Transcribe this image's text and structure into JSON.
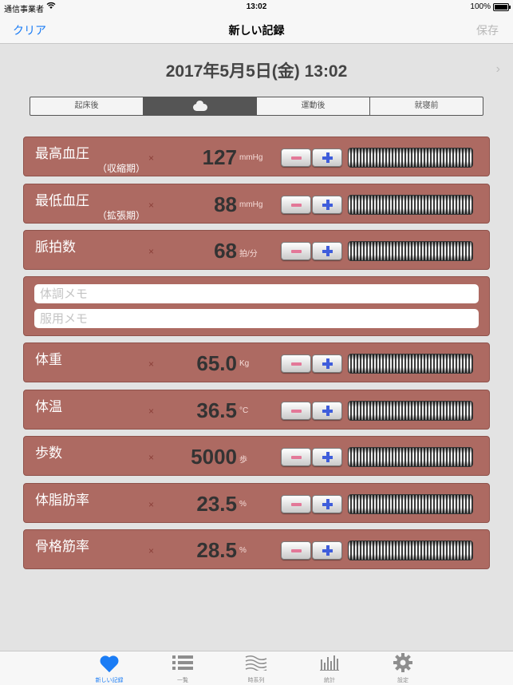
{
  "status_bar": {
    "carrier": "通信事業者",
    "time": "13:02",
    "battery": "100%"
  },
  "nav": {
    "left": "クリア",
    "title": "新しい記録",
    "right": "保存"
  },
  "date": "2017年5月5日(金) 13:02",
  "segments": [
    "起床後",
    "",
    "運動後",
    "就寝前"
  ],
  "selected_segment": 1,
  "metrics": [
    {
      "label": "最高血圧",
      "sublabel": "（収縮期）",
      "times": "×",
      "value": "127",
      "unit": "mmHg"
    },
    {
      "label": "最低血圧",
      "sublabel": "（拡張期）",
      "times": "×",
      "value": "88",
      "unit": "mmHg"
    },
    {
      "label": "脈拍数",
      "sublabel": "",
      "times": "×",
      "value": "68",
      "unit": "拍/分"
    }
  ],
  "memo": {
    "condition_placeholder": "体調メモ",
    "medication_placeholder": "服用メモ"
  },
  "metrics2": [
    {
      "label": "体重",
      "times": "×",
      "value": "65.0",
      "unit": "Kg"
    },
    {
      "label": "体温",
      "times": "×",
      "value": "36.5",
      "unit": "°C"
    },
    {
      "label": "歩数",
      "times": "×",
      "value": "5000",
      "unit": "歩"
    },
    {
      "label": "体脂肪率",
      "times": "×",
      "value": "23.5",
      "unit": "%"
    },
    {
      "label": "骨格筋率",
      "times": "×",
      "value": "28.5",
      "unit": "%"
    }
  ],
  "tabs": [
    {
      "label": "新しい記録",
      "icon": "heart-icon"
    },
    {
      "label": "一覧",
      "icon": "list-icon"
    },
    {
      "label": "時系列",
      "icon": "waves-icon"
    },
    {
      "label": "統計",
      "icon": "bar-chart-icon"
    },
    {
      "label": "設定",
      "icon": "gear-icon"
    }
  ],
  "colors": {
    "accent": "#1a7cf5",
    "card": "#ad6a62",
    "minus": "#e37898",
    "plus": "#3f5ddb"
  }
}
